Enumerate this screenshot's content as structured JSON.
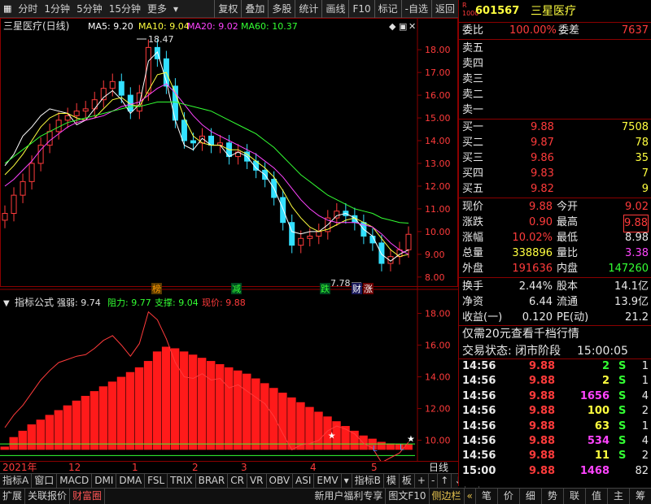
{
  "toolbar": {
    "left": [
      "分时",
      "1分钟",
      "5分钟",
      "15分钟",
      "更多"
    ],
    "right": [
      "复权",
      "叠加",
      "多股",
      "统计",
      "画线",
      "F10",
      "标记",
      "-自选",
      "返回"
    ]
  },
  "chart_header": {
    "name": "三星医疗(日线)",
    "ma5": "MA5: 9.20",
    "ma10": "MA10: 9.04",
    "ma20": "MA20: 9.02",
    "ma60": "MA60: 10.37",
    "high_marker": "18.47",
    "low_marker": "7.78",
    "badges": [
      "榜",
      "减",
      "跌",
      "财",
      "涨"
    ]
  },
  "indicator_header": {
    "name": "指标公式",
    "strength": "强弱: 9.74",
    "resistance": "阻力: 9.77",
    "support": "支撑: 9.04",
    "current": "现价: 9.88"
  },
  "colors": {
    "up": "#ff3b3b",
    "down": "#33e0ff",
    "ma5": "#ffffff",
    "ma10": "#ffff3f",
    "ma20": "#ff44ff",
    "ma60": "#33ff33",
    "grid": "#8b0000"
  },
  "chart_data": [
    {
      "type": "line",
      "title": "三星医疗(日线)",
      "yticks": [
        8.0,
        9.0,
        10.0,
        11.0,
        12.0,
        13.0,
        14.0,
        15.0,
        16.0,
        17.0,
        18.0
      ],
      "ylim": [
        7.6,
        18.9
      ],
      "series": [
        {
          "name": "MA5",
          "values": [
            12.9,
            13.4,
            14.2,
            14.6,
            15.1,
            15.4,
            15.3,
            15.2,
            14.7,
            14.9,
            15.4,
            15.9,
            16.2,
            15.8,
            15.2,
            15.6,
            17.5,
            17.9,
            16.6,
            14.9,
            13.8,
            13.6,
            14.1,
            13.8,
            13.8,
            13.3,
            13.5,
            13.3,
            12.8,
            12.5,
            11.9,
            11.0,
            10.0,
            9.9,
            10.0,
            10.0,
            10.3,
            10.7,
            10.8,
            10.6,
            10.1,
            9.8,
            9.0,
            8.7,
            9.0,
            9.2
          ]
        },
        {
          "name": "MA10",
          "values": [
            12.5,
            12.9,
            13.4,
            14.0,
            14.6,
            15.0,
            15.2,
            15.2,
            15.0,
            14.9,
            15.0,
            15.4,
            15.8,
            15.9,
            15.6,
            15.5,
            16.2,
            16.9,
            17.0,
            16.1,
            15.0,
            14.2,
            13.9,
            13.8,
            13.8,
            13.6,
            13.6,
            13.4,
            13.1,
            12.8,
            12.4,
            11.8,
            11.1,
            10.6,
            10.2,
            10.0,
            10.1,
            10.3,
            10.5,
            10.6,
            10.4,
            10.2,
            9.7,
            9.2,
            8.9,
            9.0
          ]
        },
        {
          "name": "MA20",
          "values": [
            12.0,
            12.3,
            12.7,
            13.1,
            13.6,
            14.0,
            14.3,
            14.6,
            14.8,
            14.9,
            15.0,
            15.1,
            15.3,
            15.5,
            15.6,
            15.7,
            16.0,
            16.3,
            16.5,
            16.1,
            15.6,
            15.1,
            14.7,
            14.4,
            14.2,
            14.0,
            13.8,
            13.6,
            13.4,
            13.1,
            12.8,
            12.4,
            11.9,
            11.4,
            11.0,
            10.7,
            10.5,
            10.4,
            10.4,
            10.4,
            10.3,
            10.2,
            9.9,
            9.5,
            9.2,
            9.0
          ]
        },
        {
          "name": "MA60",
          "values": [
            13.0,
            13.3,
            13.6,
            13.9,
            14.2,
            14.4,
            14.6,
            14.8,
            14.9,
            15.0,
            15.1,
            15.2,
            15.3,
            15.4,
            15.5,
            15.5,
            15.6,
            15.7,
            15.7,
            15.7,
            15.6,
            15.5,
            15.4,
            15.3,
            15.1,
            14.9,
            14.7,
            14.5,
            14.3,
            14.0,
            13.7,
            13.3,
            12.9,
            12.5,
            12.2,
            11.9,
            11.6,
            11.4,
            11.2,
            11.0,
            10.9,
            10.8,
            10.6,
            10.5,
            10.4,
            10.37
          ]
        }
      ]
    },
    {
      "type": "bar",
      "title": "指标公式",
      "yticks": [
        10.0,
        12.0,
        14.0,
        16.0,
        18.0
      ],
      "ylim": [
        8.8,
        18.9
      ],
      "note_values": "red bars = 强弱 level per day",
      "values": [
        9.6,
        10.2,
        10.6,
        11.0,
        11.3,
        11.6,
        11.9,
        12.2,
        12.5,
        12.8,
        13.1,
        13.4,
        13.7,
        14.0,
        14.3,
        14.6,
        15.0,
        15.6,
        15.9,
        15.8,
        15.6,
        15.4,
        15.2,
        15.0,
        14.8,
        14.6,
        14.4,
        14.2,
        13.9,
        13.6,
        13.3,
        13.0,
        12.7,
        12.4,
        12.1,
        11.8,
        11.5,
        11.2,
        10.9,
        10.6,
        10.3,
        10.1,
        9.9,
        9.8,
        9.75,
        9.74
      ],
      "price_line": [
        10.8,
        11.6,
        12.2,
        13.0,
        13.8,
        14.4,
        14.9,
        15.1,
        15.3,
        15.4,
        15.8,
        16.3,
        16.6,
        16.0,
        15.3,
        16.1,
        18.1,
        17.6,
        16.4,
        14.9,
        14.0,
        13.9,
        14.2,
        13.8,
        13.9,
        13.3,
        13.5,
        13.1,
        12.7,
        12.3,
        11.5,
        10.4,
        9.4,
        9.7,
        9.8,
        10.0,
        10.6,
        10.9,
        10.7,
        10.4,
        9.8,
        9.5,
        8.6,
        8.9,
        9.2,
        9.88
      ]
    }
  ],
  "date_axis": {
    "labels": [
      "2021年",
      "12",
      "1",
      "2",
      "3",
      "4",
      "5"
    ],
    "right_label": "日线"
  },
  "bottom_tabs1": [
    "指标A",
    "窗口",
    "MACD",
    "DMI",
    "DMA",
    "FSL",
    "TRIX",
    "BRAR",
    "CR",
    "VR",
    "OBV",
    "ASI",
    "EMV",
    "指标B",
    "模",
    "板"
  ],
  "bottom_tabs2": [
    "扩展",
    "关联报价",
    "财富圈",
    "新用户福利专享",
    "图文F10",
    "侧边栏"
  ],
  "bottom_tabs2_right": [
    "笔",
    "价",
    "细",
    "势",
    "联",
    "值",
    "主",
    "筹"
  ],
  "quote": {
    "code": "601567",
    "name": "三星医疗",
    "weibi_label": "委比",
    "weibi": "100.00%",
    "weicha_label": "委差",
    "weicha": "7637",
    "asks": [
      {
        "label": "卖五",
        "price": "",
        "vol": ""
      },
      {
        "label": "卖四",
        "price": "",
        "vol": ""
      },
      {
        "label": "卖三",
        "price": "",
        "vol": ""
      },
      {
        "label": "卖二",
        "price": "",
        "vol": ""
      },
      {
        "label": "卖一",
        "price": "",
        "vol": ""
      }
    ],
    "bids": [
      {
        "label": "买一",
        "price": "9.88",
        "vol": "7508"
      },
      {
        "label": "买二",
        "price": "9.87",
        "vol": "78"
      },
      {
        "label": "买三",
        "price": "9.86",
        "vol": "35"
      },
      {
        "label": "买四",
        "price": "9.83",
        "vol": "7"
      },
      {
        "label": "买五",
        "price": "9.82",
        "vol": "9"
      }
    ],
    "stats": [
      {
        "l1": "现价",
        "v1": "9.88",
        "l2": "今开",
        "v2": "9.02"
      },
      {
        "l1": "涨跌",
        "v1": "0.90",
        "l2": "最高",
        "v2": "9.88"
      },
      {
        "l1": "涨幅",
        "v1": "10.02%",
        "l2": "最低",
        "v2": "8.98"
      },
      {
        "l1": "总量",
        "v1": "338896",
        "l2": "量比",
        "v2": "3.38"
      },
      {
        "l1": "外盘",
        "v1": "191636",
        "l2": "内盘",
        "v2": "147260"
      }
    ],
    "stats2": [
      {
        "l1": "换手",
        "v1": "2.44%",
        "l2": "股本",
        "v2": "14.1亿"
      },
      {
        "l1": "净资",
        "v1": "6.44",
        "l2": "流通",
        "v2": "13.9亿"
      },
      {
        "l1": "收益(一)",
        "v1": "0.120",
        "l2": "PE(动)",
        "v2": "21.2"
      }
    ],
    "promo": "仅需20元查看千档行情",
    "trade_status_label": "交易状态: 闭市阶段",
    "trade_status_time": "15:00:05",
    "ticks": [
      {
        "t": "14:56",
        "p": "9.88",
        "v": "2",
        "s": "S",
        "n": "1"
      },
      {
        "t": "14:56",
        "p": "9.88",
        "v": "2",
        "s": "S",
        "n": "1"
      },
      {
        "t": "14:56",
        "p": "9.88",
        "v": "1656",
        "s": "S",
        "n": "4"
      },
      {
        "t": "14:56",
        "p": "9.88",
        "v": "100",
        "s": "S",
        "n": "2"
      },
      {
        "t": "14:56",
        "p": "9.88",
        "v": "63",
        "s": "S",
        "n": "1"
      },
      {
        "t": "14:56",
        "p": "9.88",
        "v": "534",
        "s": "S",
        "n": "4"
      },
      {
        "t": "14:56",
        "p": "9.88",
        "v": "11",
        "s": "S",
        "n": "2"
      },
      {
        "t": "15:00",
        "p": "9.88",
        "v": "1468",
        "s": "",
        "n": "82"
      }
    ]
  }
}
